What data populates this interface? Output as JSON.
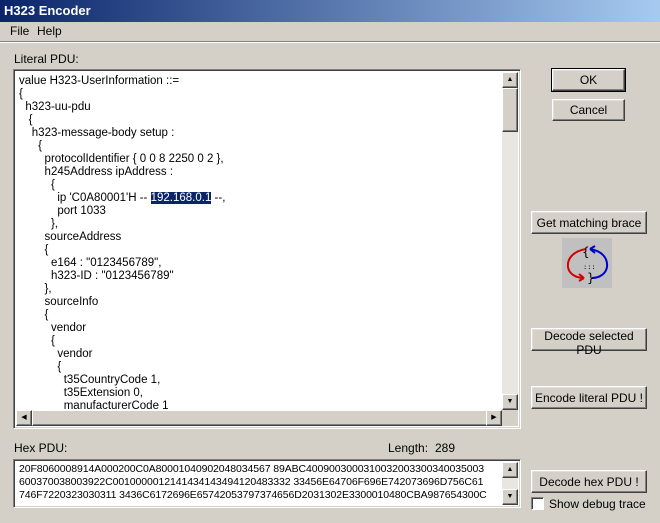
{
  "window": {
    "title": "H323 Encoder"
  },
  "menu": {
    "file": "File",
    "help": "Help"
  },
  "literal": {
    "label": "Literal PDU:",
    "lines": [
      "value H323-UserInformation ::=",
      "{",
      "  h323-uu-pdu",
      "   {",
      "    h323-message-body setup :",
      "      {",
      "        protocolIdentifier { 0 0 8 2250 0 2 },",
      "        h245Address ipAddress :",
      "          {",
      "            ip 'C0A80001'H -- ",
      "            port 1033",
      "          },",
      "        sourceAddress",
      "        {",
      "          e164 : \"0123456789\",",
      "          h323-ID : \"0123456789\"",
      "        },",
      "        sourceInfo",
      "        {",
      "          vendor",
      "          {",
      "            vendor",
      "            {",
      "              t35CountryCode 1,",
      "              t35Extension 0,",
      "              manufacturerCode 1"
    ],
    "selected_text": "192.168.0.1",
    "after_selection": " --,"
  },
  "hex": {
    "label": "Hex PDU:",
    "length_label": "Length:",
    "length_value": "289",
    "lines": [
      "20F8060008914A000200C0A80001040902048034567 89ABC4009003000310032003300340035003",
      "600370038003922C0010000012141434143494120483332 33456E64706F696E742073696D756C61",
      "746F7220323030311 3436C6172696E65742053797374656D2031302E3300010480CBA987654300C"
    ]
  },
  "buttons": {
    "ok": "OK",
    "cancel": "Cancel",
    "matching_brace": "Get matching brace",
    "decode_selected": "Decode selected PDU",
    "encode_literal": "Encode literal PDU !",
    "decode_hex": "Decode hex PDU !"
  },
  "debug": {
    "label": "Show debug trace",
    "checked": false
  }
}
